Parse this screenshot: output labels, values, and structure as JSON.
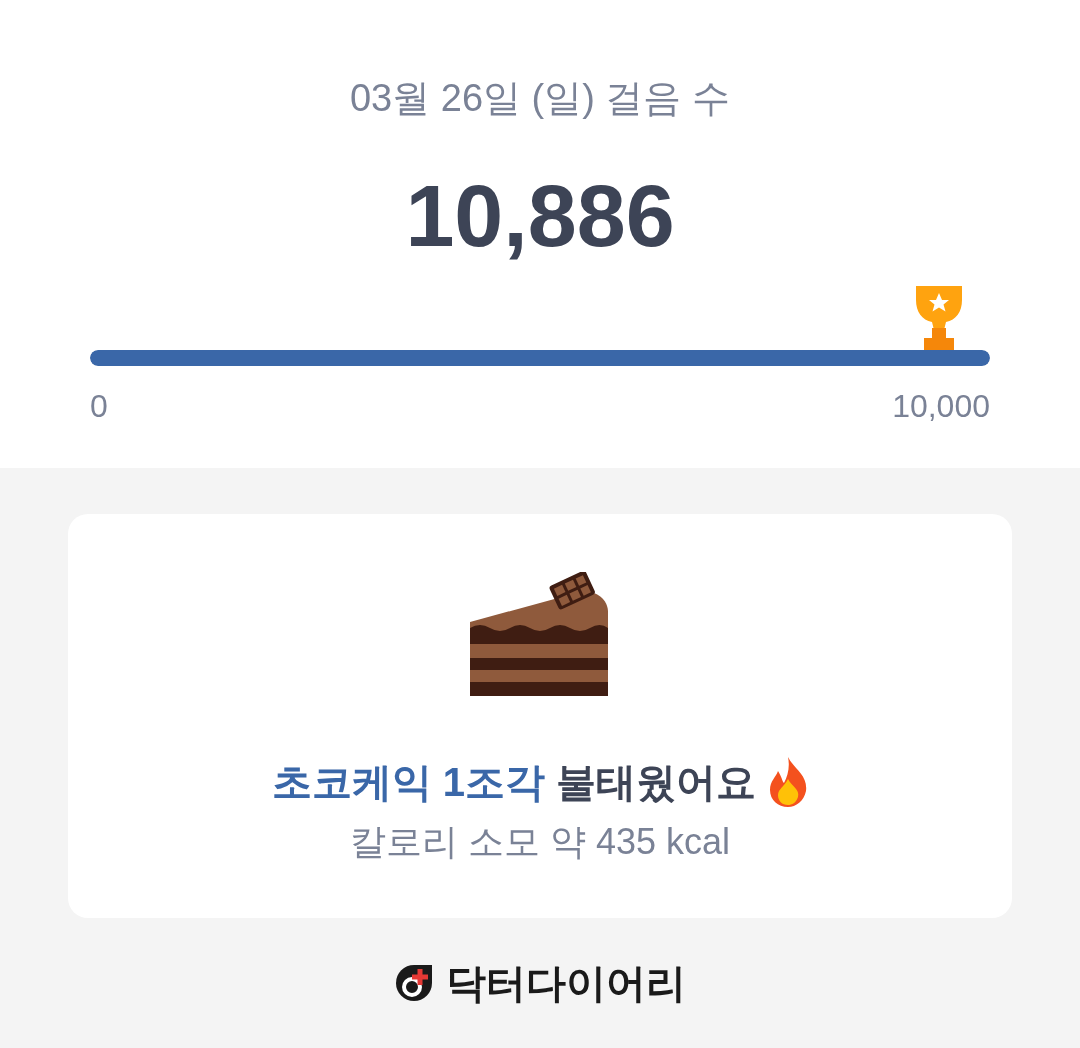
{
  "header": {
    "title": "03월 26일 (일) 걸음 수",
    "steps": "10,886"
  },
  "progress": {
    "level": 1,
    "min_label": "0",
    "goal_label": "10,000"
  },
  "card": {
    "highlight": "초코케익 1조각",
    "message": "불태웠어요",
    "subtitle": "칼로리 소모 약 435 kcal"
  },
  "footer": {
    "brand": "닥터다이어리"
  }
}
